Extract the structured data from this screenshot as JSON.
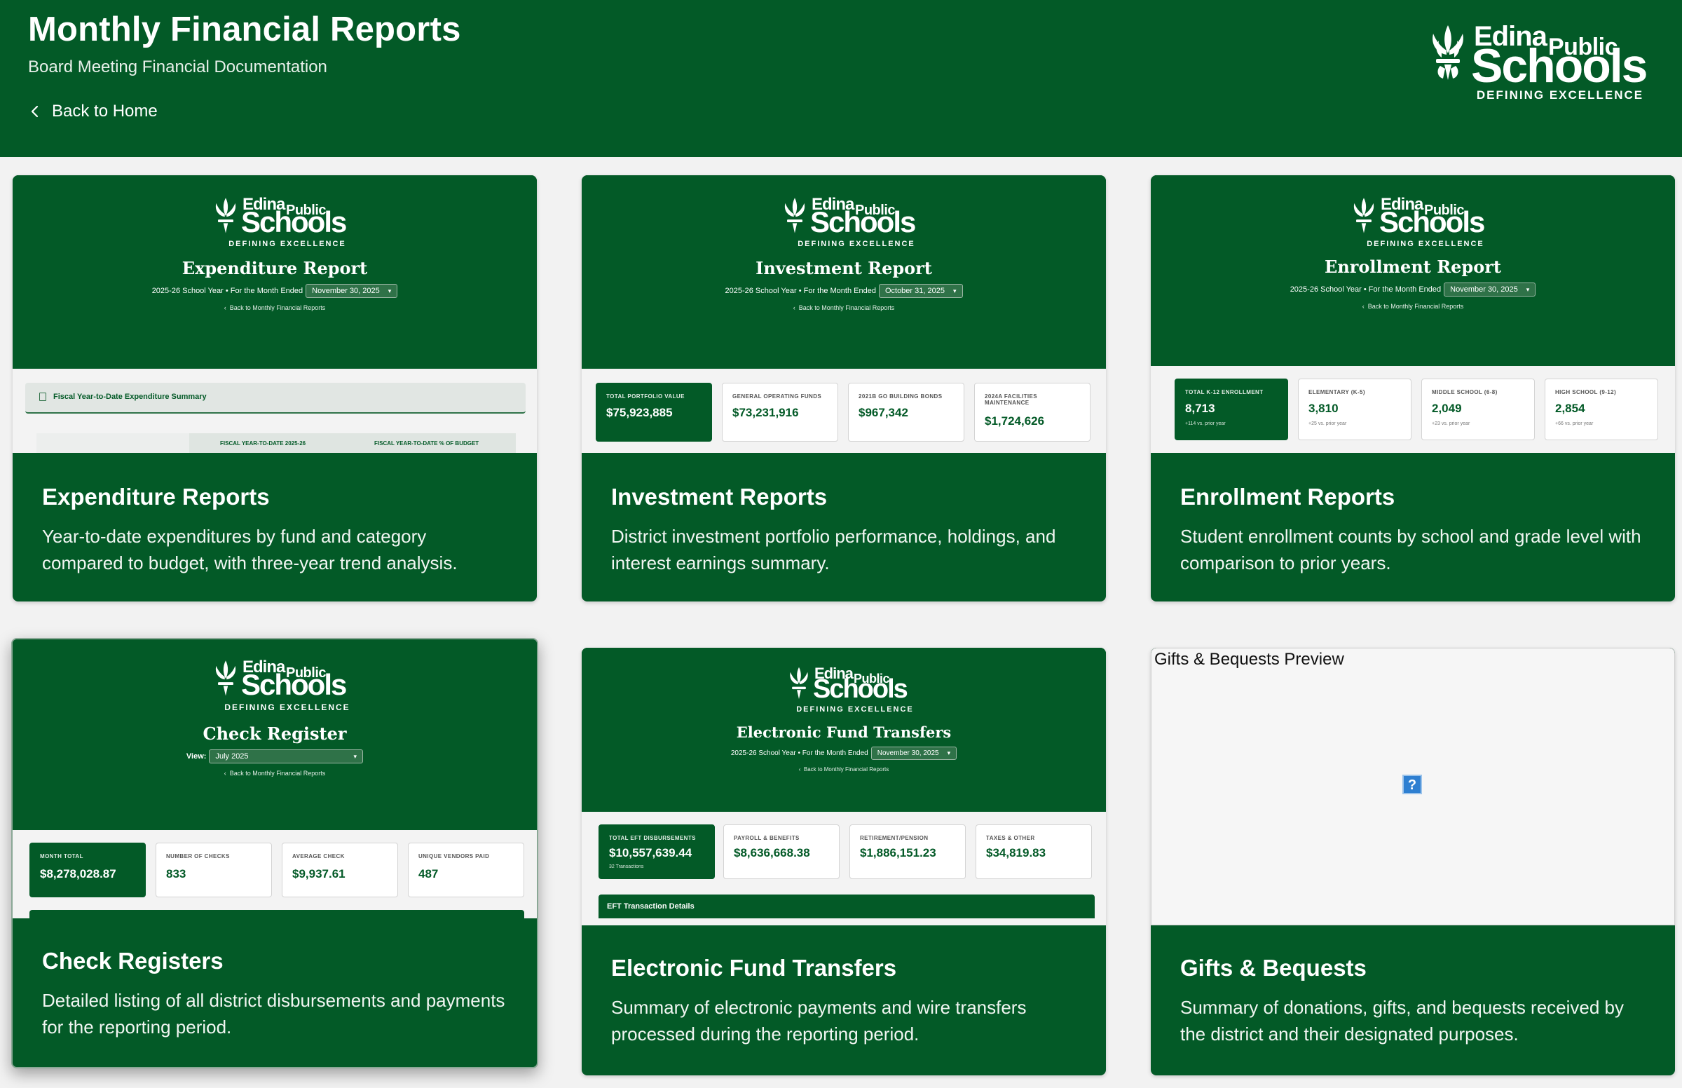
{
  "header": {
    "title": "Monthly Financial Reports",
    "subtitle": "Board Meeting Financial Documentation",
    "back_label": "Back to Home"
  },
  "logo": {
    "edina": "Edina",
    "public": "Public",
    "schools": "Schools",
    "tagline": "DEFINING EXCELLENCE"
  },
  "cards": [
    {
      "title": "Expenditure Reports",
      "description": "Year-to-date expenditures by fund and category compared to budget, with three-year trend analysis.",
      "preview": {
        "report_title": "Expenditure Report",
        "meta": "2025-26 School Year • For the Month Ended",
        "selected": "November 30, 2025",
        "back": "Back to Monthly Financial Reports",
        "section": "Fiscal Year-to-Date Expenditure Summary",
        "col1": "FISCAL YEAR-TO-DATE 2025-26",
        "col2": "FISCAL YEAR-TO-DATE % OF BUDGET"
      }
    },
    {
      "title": "Investment Reports",
      "description": "District investment portfolio performance, holdings, and interest earnings summary.",
      "preview": {
        "report_title": "Investment Report",
        "meta": "2025-26 School Year • For the Month Ended",
        "selected": "October 31, 2025",
        "back": "Back to Monthly Financial Reports",
        "stats": [
          {
            "label": "TOTAL PORTFOLIO VALUE",
            "value": "$75,923,885"
          },
          {
            "label": "GENERAL OPERATING FUNDS",
            "value": "$73,231,916"
          },
          {
            "label": "2021B GO BUILDING BONDS",
            "value": "$967,342"
          },
          {
            "label": "2024A FACILITIES MAINTENANCE",
            "value": "$1,724,626"
          }
        ]
      }
    },
    {
      "title": "Enrollment Reports",
      "description": "Student enrollment counts by school and grade level with comparison to prior years.",
      "preview": {
        "report_title": "Enrollment Report",
        "meta": "2025-26 School Year • For the Month Ended",
        "selected": "November 30, 2025",
        "back": "Back to Monthly Financial Reports",
        "stats": [
          {
            "label": "TOTAL K-12 ENROLLMENT",
            "value": "8,713",
            "note": "+114 vs. prior year"
          },
          {
            "label": "ELEMENTARY (K-5)",
            "value": "3,810",
            "note": "+25 vs. prior year"
          },
          {
            "label": "MIDDLE SCHOOL (6-8)",
            "value": "2,049",
            "note": "+23 vs. prior year"
          },
          {
            "label": "HIGH SCHOOL (9-12)",
            "value": "2,854",
            "note": "+66 vs. prior year"
          }
        ]
      }
    },
    {
      "title": "Check Registers",
      "description": "Detailed listing of all district disbursements and payments for the reporting period.",
      "preview": {
        "report_title": "Check Register",
        "view_label": "View:",
        "selected": "July 2025",
        "back": "Back to Monthly Financial Reports",
        "stats": [
          {
            "label": "MONTH TOTAL",
            "value": "$8,278,028.87"
          },
          {
            "label": "NUMBER OF CHECKS",
            "value": "833"
          },
          {
            "label": "AVERAGE CHECK",
            "value": "$9,937.61"
          },
          {
            "label": "UNIQUE VENDORS PAID",
            "value": "487"
          }
        ]
      }
    },
    {
      "title": "Electronic Fund Transfers",
      "description": "Summary of electronic payments and wire transfers processed during the reporting period.",
      "preview": {
        "report_title": "Electronic Fund Transfers",
        "meta": "2025-26 School Year • For the Month Ended",
        "selected": "November 30, 2025",
        "back": "Back to Monthly Financial Reports",
        "stats": [
          {
            "label": "TOTAL EFT DISBURSEMENTS",
            "value": "$10,557,639.44",
            "note": "32 Transactions"
          },
          {
            "label": "PAYROLL & BENEFITS",
            "value": "$8,636,668.38"
          },
          {
            "label": "RETIREMENT/PENSION",
            "value": "$1,886,151.23"
          },
          {
            "label": "TAXES & OTHER",
            "value": "$34,819.83"
          }
        ],
        "section": "EFT Transaction Details"
      }
    },
    {
      "title": "Gifts & Bequests",
      "description": "Summary of donations, gifts, and bequests received by the district and their designated purposes.",
      "preview": {
        "alt_text": "Gifts & Bequests Preview",
        "broken_glyph": "?"
      }
    }
  ],
  "colors": {
    "brand_green": "#035a27",
    "page_bg": "#f2f2f2"
  }
}
